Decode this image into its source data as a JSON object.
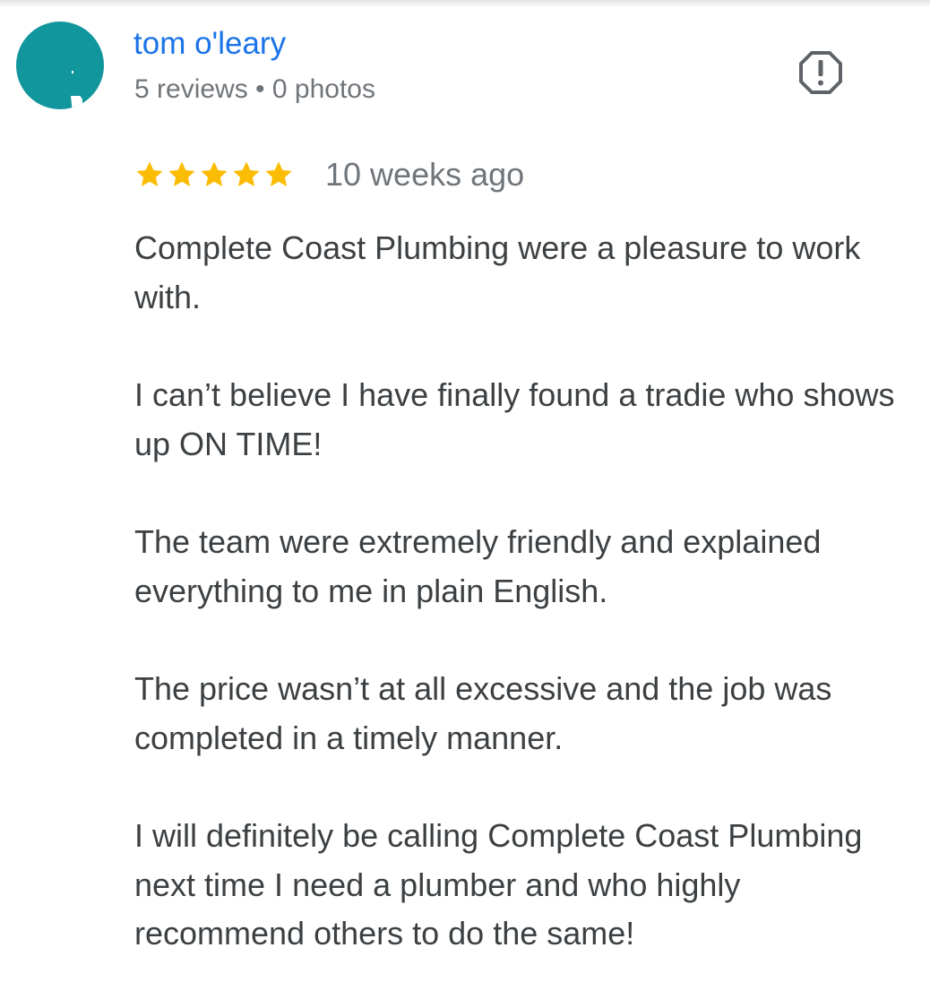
{
  "review": {
    "author": {
      "name": "tom o'leary",
      "stats": "5 reviews • 0 photos",
      "avatar_color": "#12969e"
    },
    "report_icon": "report-flag-icon",
    "rating": 5,
    "star_icon": "star-icon",
    "star_color": "#fbbc04",
    "date": "10 weeks ago",
    "paragraphs": [
      "Complete Coast Plumbing were a pleasure to work with.",
      "I can’t believe I have finally found a tradie who shows up ON TIME!",
      "The team were extremely friendly and explained everything to me in plain English.",
      "The price wasn’t at all excessive and the job was completed in a timely manner.",
      "I will definitely be calling Complete Coast Plumbing next time I need a plumber and who highly recommend others to do the same!"
    ]
  }
}
